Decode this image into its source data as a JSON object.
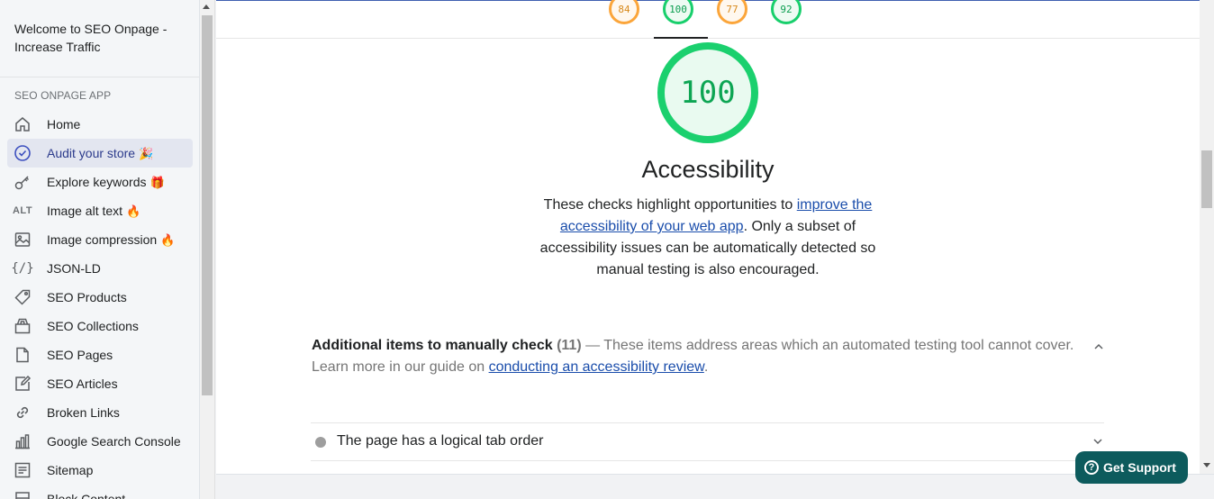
{
  "sidebar": {
    "app_title": "Welcome to SEO Onpage - Increase Traffic",
    "section_label": "SEO ONPAGE APP",
    "items": [
      {
        "label": "Home",
        "icon": "home-icon",
        "emoji": ""
      },
      {
        "label": "Audit your store",
        "icon": "check-circle-icon",
        "emoji": "🎉"
      },
      {
        "label": "Explore keywords",
        "icon": "key-icon",
        "emoji": "🎁"
      },
      {
        "label": "Image alt text",
        "icon": "alt-icon",
        "icon_text": "ALT",
        "emoji": "🔥"
      },
      {
        "label": "Image compression",
        "icon": "image-icon",
        "emoji": "🔥"
      },
      {
        "label": "JSON-LD",
        "icon": "code-braces-icon",
        "icon_text": "{/}",
        "emoji": ""
      },
      {
        "label": "SEO Products",
        "icon": "tag-icon",
        "emoji": ""
      },
      {
        "label": "SEO Collections",
        "icon": "collections-icon",
        "emoji": ""
      },
      {
        "label": "SEO Pages",
        "icon": "page-icon",
        "emoji": ""
      },
      {
        "label": "SEO Articles",
        "icon": "edit-icon",
        "emoji": ""
      },
      {
        "label": "Broken Links",
        "icon": "link-icon",
        "emoji": ""
      },
      {
        "label": "Google Search Console",
        "icon": "analytics-icon",
        "emoji": ""
      },
      {
        "label": "Sitemap",
        "icon": "list-icon",
        "emoji": ""
      },
      {
        "label": "Block Content",
        "icon": "block-icon",
        "emoji": ""
      }
    ]
  },
  "scores": {
    "tabs": [
      {
        "value": "84",
        "status": "average"
      },
      {
        "value": "100",
        "status": "pass"
      },
      {
        "value": "77",
        "status": "average"
      },
      {
        "value": "92",
        "status": "pass"
      }
    ],
    "active_tab_index": 1
  },
  "category": {
    "score": "100",
    "title": "Accessibility",
    "desc_before": "These checks highlight opportunities to ",
    "desc_link": "improve the accessibility of your web app",
    "desc_after": ". Only a subset of accessibility issues can be automatically detected so manual testing is also encouraged."
  },
  "manual": {
    "title": "Additional items to manually check",
    "count": "(11)",
    "desc": " — These items address areas which an automated testing tool cannot cover. Learn more in our guide on ",
    "link": "conducting an accessibility review",
    "end": "."
  },
  "audits": [
    {
      "label": "The page has a logical tab order"
    }
  ],
  "support": {
    "label": "Get Support",
    "icon": "help-icon"
  },
  "colors": {
    "pass": "#18cf6c",
    "average": "#fba53a",
    "active_nav": "#e3e6f0",
    "support_bg": "#0d5b5d",
    "link": "#1a4dab"
  }
}
